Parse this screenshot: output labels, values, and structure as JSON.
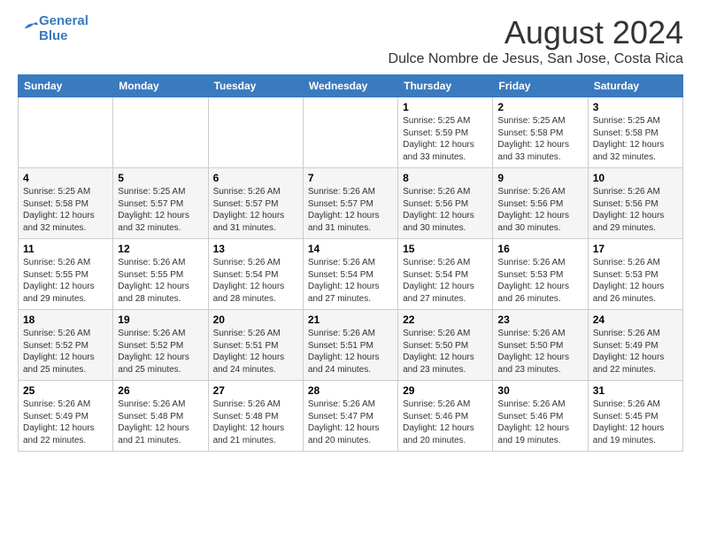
{
  "header": {
    "logo_line1": "General",
    "logo_line2": "Blue",
    "month_title": "August 2024",
    "location": "Dulce Nombre de Jesus, San Jose, Costa Rica"
  },
  "days_of_week": [
    "Sunday",
    "Monday",
    "Tuesday",
    "Wednesday",
    "Thursday",
    "Friday",
    "Saturday"
  ],
  "weeks": [
    [
      {
        "day": "",
        "info": ""
      },
      {
        "day": "",
        "info": ""
      },
      {
        "day": "",
        "info": ""
      },
      {
        "day": "",
        "info": ""
      },
      {
        "day": "1",
        "info": "Sunrise: 5:25 AM\nSunset: 5:59 PM\nDaylight: 12 hours\nand 33 minutes."
      },
      {
        "day": "2",
        "info": "Sunrise: 5:25 AM\nSunset: 5:58 PM\nDaylight: 12 hours\nand 33 minutes."
      },
      {
        "day": "3",
        "info": "Sunrise: 5:25 AM\nSunset: 5:58 PM\nDaylight: 12 hours\nand 32 minutes."
      }
    ],
    [
      {
        "day": "4",
        "info": "Sunrise: 5:25 AM\nSunset: 5:58 PM\nDaylight: 12 hours\nand 32 minutes."
      },
      {
        "day": "5",
        "info": "Sunrise: 5:25 AM\nSunset: 5:57 PM\nDaylight: 12 hours\nand 32 minutes."
      },
      {
        "day": "6",
        "info": "Sunrise: 5:26 AM\nSunset: 5:57 PM\nDaylight: 12 hours\nand 31 minutes."
      },
      {
        "day": "7",
        "info": "Sunrise: 5:26 AM\nSunset: 5:57 PM\nDaylight: 12 hours\nand 31 minutes."
      },
      {
        "day": "8",
        "info": "Sunrise: 5:26 AM\nSunset: 5:56 PM\nDaylight: 12 hours\nand 30 minutes."
      },
      {
        "day": "9",
        "info": "Sunrise: 5:26 AM\nSunset: 5:56 PM\nDaylight: 12 hours\nand 30 minutes."
      },
      {
        "day": "10",
        "info": "Sunrise: 5:26 AM\nSunset: 5:56 PM\nDaylight: 12 hours\nand 29 minutes."
      }
    ],
    [
      {
        "day": "11",
        "info": "Sunrise: 5:26 AM\nSunset: 5:55 PM\nDaylight: 12 hours\nand 29 minutes."
      },
      {
        "day": "12",
        "info": "Sunrise: 5:26 AM\nSunset: 5:55 PM\nDaylight: 12 hours\nand 28 minutes."
      },
      {
        "day": "13",
        "info": "Sunrise: 5:26 AM\nSunset: 5:54 PM\nDaylight: 12 hours\nand 28 minutes."
      },
      {
        "day": "14",
        "info": "Sunrise: 5:26 AM\nSunset: 5:54 PM\nDaylight: 12 hours\nand 27 minutes."
      },
      {
        "day": "15",
        "info": "Sunrise: 5:26 AM\nSunset: 5:54 PM\nDaylight: 12 hours\nand 27 minutes."
      },
      {
        "day": "16",
        "info": "Sunrise: 5:26 AM\nSunset: 5:53 PM\nDaylight: 12 hours\nand 26 minutes."
      },
      {
        "day": "17",
        "info": "Sunrise: 5:26 AM\nSunset: 5:53 PM\nDaylight: 12 hours\nand 26 minutes."
      }
    ],
    [
      {
        "day": "18",
        "info": "Sunrise: 5:26 AM\nSunset: 5:52 PM\nDaylight: 12 hours\nand 25 minutes."
      },
      {
        "day": "19",
        "info": "Sunrise: 5:26 AM\nSunset: 5:52 PM\nDaylight: 12 hours\nand 25 minutes."
      },
      {
        "day": "20",
        "info": "Sunrise: 5:26 AM\nSunset: 5:51 PM\nDaylight: 12 hours\nand 24 minutes."
      },
      {
        "day": "21",
        "info": "Sunrise: 5:26 AM\nSunset: 5:51 PM\nDaylight: 12 hours\nand 24 minutes."
      },
      {
        "day": "22",
        "info": "Sunrise: 5:26 AM\nSunset: 5:50 PM\nDaylight: 12 hours\nand 23 minutes."
      },
      {
        "day": "23",
        "info": "Sunrise: 5:26 AM\nSunset: 5:50 PM\nDaylight: 12 hours\nand 23 minutes."
      },
      {
        "day": "24",
        "info": "Sunrise: 5:26 AM\nSunset: 5:49 PM\nDaylight: 12 hours\nand 22 minutes."
      }
    ],
    [
      {
        "day": "25",
        "info": "Sunrise: 5:26 AM\nSunset: 5:49 PM\nDaylight: 12 hours\nand 22 minutes."
      },
      {
        "day": "26",
        "info": "Sunrise: 5:26 AM\nSunset: 5:48 PM\nDaylight: 12 hours\nand 21 minutes."
      },
      {
        "day": "27",
        "info": "Sunrise: 5:26 AM\nSunset: 5:48 PM\nDaylight: 12 hours\nand 21 minutes."
      },
      {
        "day": "28",
        "info": "Sunrise: 5:26 AM\nSunset: 5:47 PM\nDaylight: 12 hours\nand 20 minutes."
      },
      {
        "day": "29",
        "info": "Sunrise: 5:26 AM\nSunset: 5:46 PM\nDaylight: 12 hours\nand 20 minutes."
      },
      {
        "day": "30",
        "info": "Sunrise: 5:26 AM\nSunset: 5:46 PM\nDaylight: 12 hours\nand 19 minutes."
      },
      {
        "day": "31",
        "info": "Sunrise: 5:26 AM\nSunset: 5:45 PM\nDaylight: 12 hours\nand 19 minutes."
      }
    ]
  ]
}
